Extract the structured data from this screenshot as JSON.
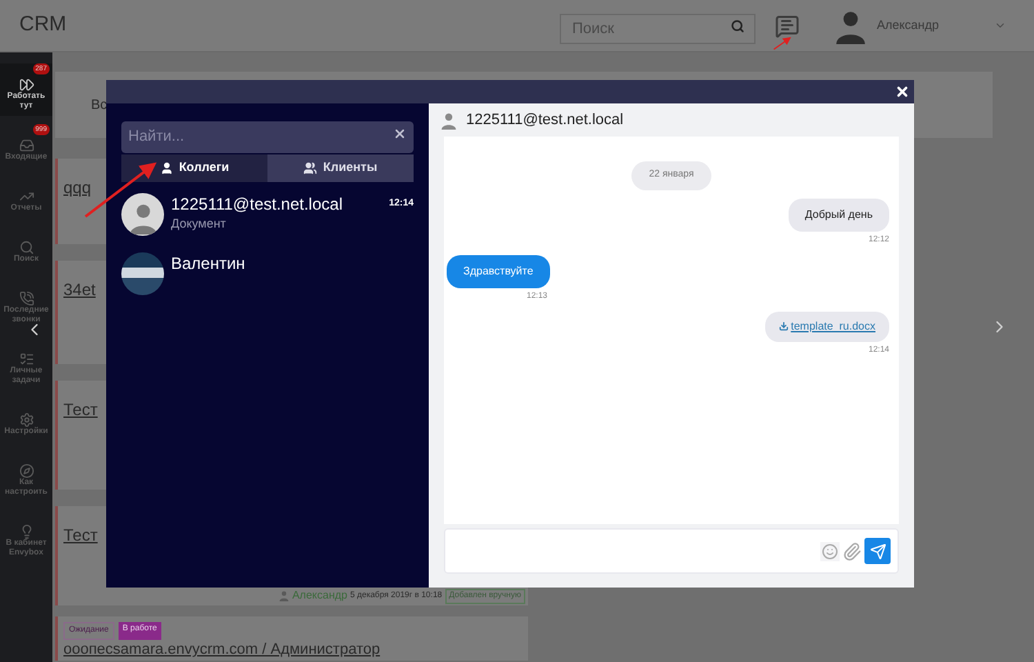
{
  "header": {
    "logo": "CRM",
    "search": {
      "placeholder": "Поиск"
    },
    "user": {
      "name": "Александр"
    }
  },
  "sidebar": {
    "items": [
      {
        "label": "Работать тут",
        "badge": "287",
        "selected": true
      },
      {
        "label": "Входящие",
        "badge": "999",
        "selected": false
      },
      {
        "label": "Отчеты",
        "selected": false
      },
      {
        "label": "Поиск",
        "selected": false
      },
      {
        "label": "Последние звонки",
        "selected": false
      },
      {
        "label": "Личные задачи",
        "selected": false
      },
      {
        "label": "Настройки",
        "selected": false
      },
      {
        "label": "Как настроить",
        "selected": false
      },
      {
        "label": "В кабинет Envybox",
        "selected": false
      }
    ]
  },
  "filter_bar": {
    "text": "Вс"
  },
  "cards": [
    {
      "title": "qqq"
    },
    {
      "title": "34et"
    },
    {
      "title": "Тест"
    },
    {
      "title": "Тест",
      "author": "Александр",
      "date": "5 декабря 2019г в 10:18",
      "source": "Добавлен вручную"
    },
    {
      "tags": [
        {
          "label": "Ожидание",
          "kind": "outline"
        },
        {
          "label": "В работе",
          "kind": "solid"
        }
      ],
      "title": "ооопесsamara.envycrm.com / Администратор"
    }
  ],
  "chat": {
    "search": {
      "placeholder": "Найти..."
    },
    "tabs": [
      {
        "label": "Коллеги",
        "selected": true
      },
      {
        "label": "Клиенты",
        "selected": false
      }
    ],
    "contacts": [
      {
        "name": "1225111@test.net.local",
        "preview": "Документ",
        "time": "12:14",
        "kind": "person"
      },
      {
        "name": "Валентин",
        "kind": "picture"
      }
    ],
    "conversation": {
      "title": "1225111@test.net.local",
      "date": "22 января",
      "messages": [
        {
          "kind": "sent",
          "text": "Добрый день",
          "time": "12:12"
        },
        {
          "kind": "received",
          "text": "Здравствуйте",
          "time": "12:13"
        },
        {
          "kind": "file",
          "text": "template_ru.docx",
          "time": "12:14"
        }
      ]
    }
  }
}
